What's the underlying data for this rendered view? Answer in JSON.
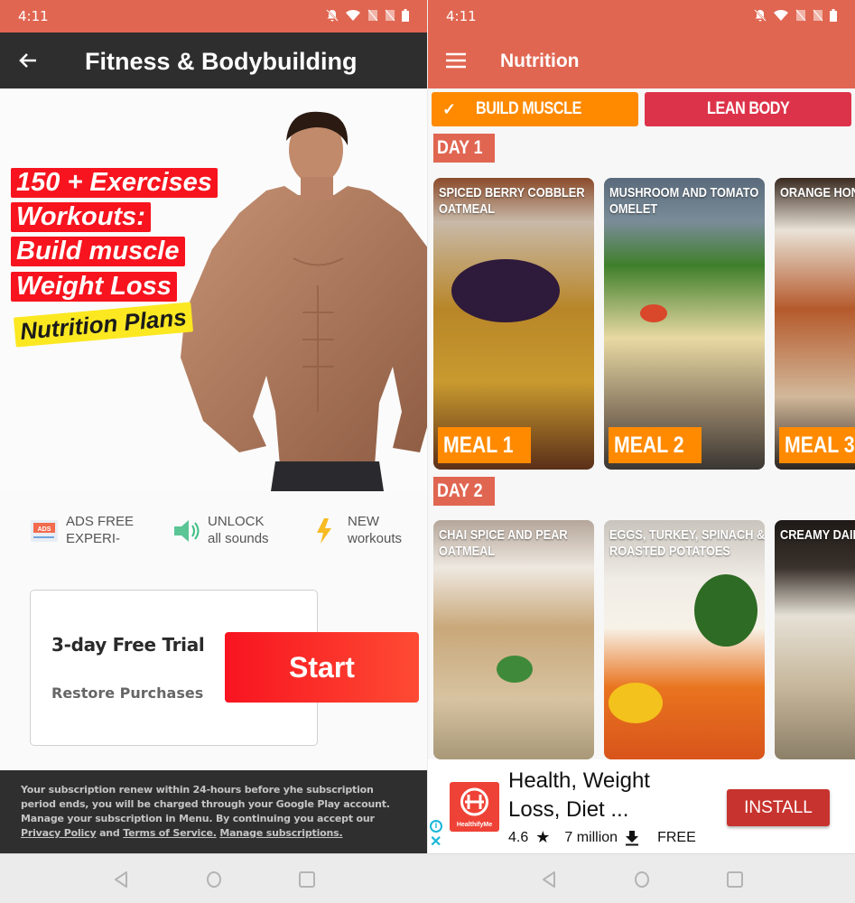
{
  "left": {
    "status": {
      "time": "4:11",
      "icons": [
        "do-not-disturb-icon",
        "wifi-icon",
        "no-sim-icon",
        "no-sim-icon",
        "battery-icon"
      ]
    },
    "appbar": {
      "title": "Fitness & Bodybuilding",
      "back_icon": "arrow-left-icon"
    },
    "hero": {
      "taglines": [
        "150 + Exercises",
        "Workouts:",
        "Build muscle",
        "Weight Loss"
      ],
      "highlight": "Nutrition Plans"
    },
    "features": [
      {
        "icon": "ads-free-icon",
        "line1": "ADS FREE",
        "line2": "EXPERI-"
      },
      {
        "icon": "speaker-icon",
        "line1": "UNLOCK",
        "line2": "all sounds"
      },
      {
        "icon": "lightning-icon",
        "line1": "NEW",
        "line2": "workouts"
      }
    ],
    "trial": {
      "title": "3-day Free Trial",
      "restore": "Restore Purchases",
      "start": "Start"
    },
    "legal": {
      "text": "Your subscription renew within 24-hours before yhe subscription period ends, you will be charged through your Google Play account. Manage your subscription in Menu. By continuing you accept our ",
      "privacy": "Privacy Policy",
      "and": " and ",
      "terms": " Terms of Service.",
      "manage": " Manage subscriptions."
    }
  },
  "right": {
    "status": {
      "time": "4:11"
    },
    "appbar": {
      "title": "Nutrition",
      "menu_icon": "hamburger-menu-icon"
    },
    "segments": {
      "build": "BUILD MUSCLE",
      "lean": "LEAN BODY",
      "selected": "build"
    },
    "days": [
      {
        "label": "DAY 1",
        "meals": [
          {
            "title": "Spiced Berry Cobbler Oatmeal",
            "badge": "MEAL 1"
          },
          {
            "title": "Mushroom and Tomato Omelet",
            "badge": "MEAL 2"
          },
          {
            "title": "Orange Honey Chicken",
            "badge": "MEAL 3"
          }
        ]
      },
      {
        "label": "DAY 2",
        "meals": [
          {
            "title": "Chai Spice and Pear Oatmeal"
          },
          {
            "title": "Eggs, Turkey, Spinach & Roasted Potatoes"
          },
          {
            "title": "Creamy Dairy Pasta"
          }
        ]
      }
    ],
    "ad": {
      "brand": "HealthifyMe",
      "title": "Health, Weight Loss, Diet ...",
      "rating": "4.6",
      "downloads": "7 million",
      "price": "FREE",
      "install": "INSTALL",
      "accent": "#c7332e"
    }
  }
}
